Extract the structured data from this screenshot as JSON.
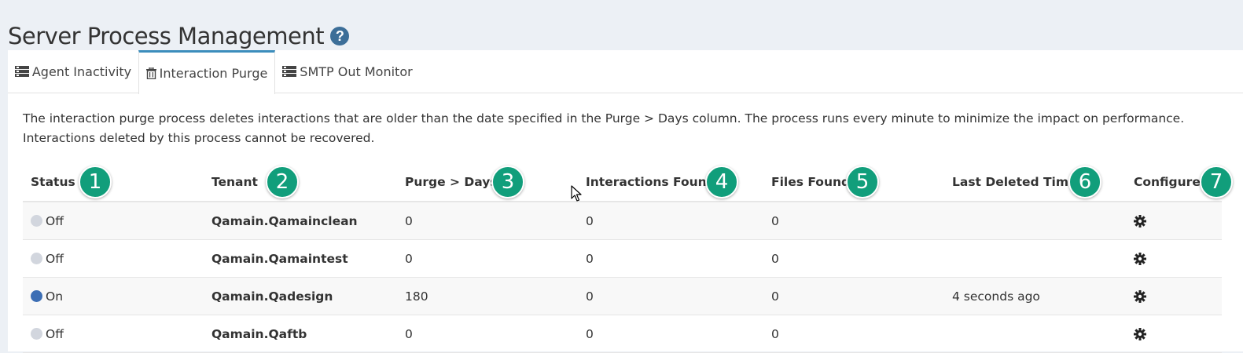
{
  "page": {
    "title": "Server Process Management",
    "help_glyph": "?"
  },
  "tabs": [
    {
      "label": "Agent Inactivity",
      "icon": "server-icon",
      "active": false
    },
    {
      "label": "Interaction Purge",
      "icon": "trash-icon",
      "active": true
    },
    {
      "label": "SMTP Out Monitor",
      "icon": "server-icon",
      "active": false
    }
  ],
  "description": "The interaction purge process deletes interactions that are older than the date specified in the Purge > Days column. The process runs every minute to minimize the impact on performance. Interactions deleted by this process cannot be recovered.",
  "table": {
    "columns": [
      {
        "label": "Status",
        "badge": "1"
      },
      {
        "label": "Tenant",
        "badge": "2"
      },
      {
        "label": "Purge > Days",
        "badge": "3"
      },
      {
        "label": "Interactions Found",
        "badge": "4"
      },
      {
        "label": "Files Found",
        "badge": "5"
      },
      {
        "label": "Last Deleted Time",
        "badge": "6"
      },
      {
        "label": "Configure",
        "badge": "7"
      }
    ],
    "rows": [
      {
        "status": "Off",
        "tenant": "Qamain.Qamainclean",
        "purge_days": "0",
        "interactions_found": "0",
        "files_found": "0",
        "last_deleted": ""
      },
      {
        "status": "Off",
        "tenant": "Qamain.Qamaintest",
        "purge_days": "0",
        "interactions_found": "0",
        "files_found": "0",
        "last_deleted": ""
      },
      {
        "status": "On",
        "tenant": "Qamain.Qadesign",
        "purge_days": "180",
        "interactions_found": "0",
        "files_found": "0",
        "last_deleted": "4 seconds ago"
      },
      {
        "status": "Off",
        "tenant": "Qamain.Qaftb",
        "purge_days": "0",
        "interactions_found": "0",
        "files_found": "0",
        "last_deleted": ""
      }
    ]
  },
  "colors": {
    "badge": "#119e7b",
    "status_on": "#3c6eb4",
    "status_off": "#d2d6de",
    "active_tab_border": "#3c8dbc"
  }
}
